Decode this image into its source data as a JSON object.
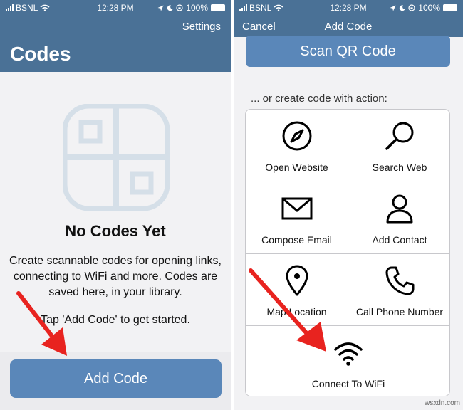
{
  "status_bar": {
    "carrier": "BSNL",
    "time": "12:28 PM",
    "battery": "100%"
  },
  "left_screen": {
    "nav": {
      "settings_label": "Settings",
      "title": "Codes"
    },
    "empty_state": {
      "icon": "qr-code-placeholder-icon",
      "title": "No Codes Yet",
      "description": "Create scannable codes for opening links, connecting to WiFi and more. Codes are saved here, in your library.",
      "hint": "Tap 'Add Code' to get started."
    },
    "add_button_label": "Add Code"
  },
  "right_screen": {
    "nav": {
      "cancel_label": "Cancel",
      "title": "Add Code"
    },
    "scan_button_label": "Scan QR Code",
    "section_header": "... or create code with action:",
    "actions": [
      {
        "label": "Open Website",
        "icon": "compass-icon"
      },
      {
        "label": "Search Web",
        "icon": "magnifier-icon"
      },
      {
        "label": "Compose Email",
        "icon": "envelope-icon"
      },
      {
        "label": "Add Contact",
        "icon": "person-icon"
      },
      {
        "label": "Map Location",
        "icon": "map-pin-icon"
      },
      {
        "label": "Call Phone Number",
        "icon": "phone-icon"
      },
      {
        "label": "Connect To WiFi",
        "icon": "wifi-icon"
      }
    ]
  },
  "annotations": {
    "arrow_color": "#e8231f"
  },
  "colors": {
    "nav_bar": "#4a7196",
    "button": "#5a87b9",
    "placeholder_art": "#d5dfe8"
  },
  "watermark": "wsxdn.com"
}
